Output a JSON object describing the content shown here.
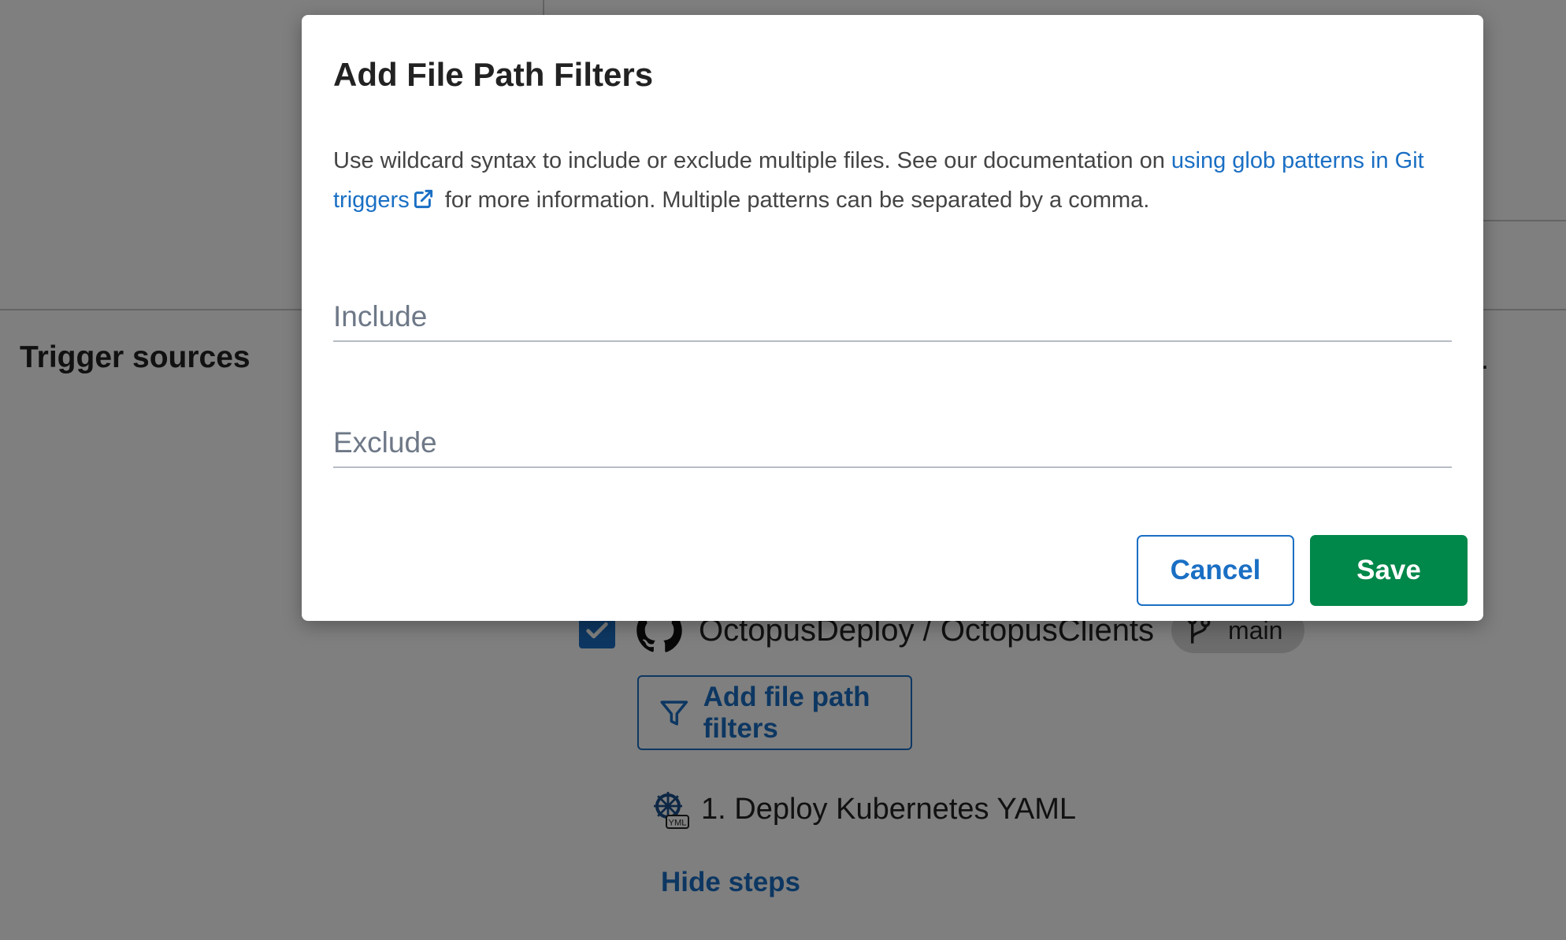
{
  "background": {
    "section_title": "Trigger sources",
    "trailing_text": "n.",
    "repository": {
      "name": "OctopusDeploy / OctopusClients",
      "branch": "main",
      "checked": true
    },
    "filter_button_label": "Add file path filters",
    "step_label": "1. Deploy Kubernetes YAML",
    "step_icon_badge": "YML",
    "hide_steps_label": "Hide steps"
  },
  "dialog": {
    "title": "Add File Path Filters",
    "description_before": "Use wildcard syntax to include or exclude multiple files. See our documentation on ",
    "description_link": "using glob patterns in Git triggers",
    "description_after": " for more information. Multiple patterns can be separated by a comma.",
    "include_placeholder": "Include",
    "include_value": "",
    "exclude_placeholder": "Exclude",
    "exclude_value": "",
    "cancel_label": "Cancel",
    "save_label": "Save"
  },
  "colors": {
    "accent": "#1a6fc4",
    "save": "#00874a",
    "overlay": "rgba(0,0,0,0.5)"
  },
  "icons": [
    "external-link-icon",
    "check-icon",
    "github-icon",
    "git-branch-icon",
    "filter-icon",
    "kubernetes-icon"
  ]
}
